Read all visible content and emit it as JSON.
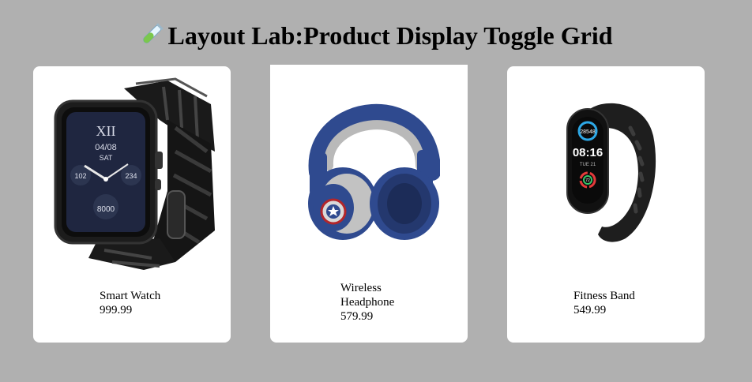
{
  "page": {
    "title": "Layout Lab:Product Display Toggle Grid",
    "title_icon": "test-tube-icon",
    "background": "#b0b0b0"
  },
  "products": [
    {
      "name": "Smart Watch",
      "price": "999.99",
      "image": "smart-watch-image"
    },
    {
      "name": "Wireless Headphone",
      "price": "579.99",
      "image": "headphone-image"
    },
    {
      "name": "Fitness Band",
      "price": "549.99",
      "image": "fitness-band-image"
    }
  ],
  "colors": {
    "card": "#ffffff",
    "headphone_blue": "#2f4a8f",
    "headphone_grey": "#b9b9b9",
    "device_black": "#1e1e1e"
  }
}
